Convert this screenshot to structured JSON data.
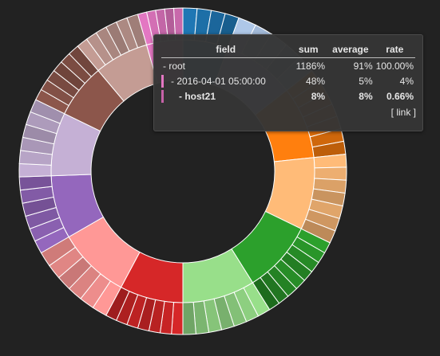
{
  "chart_data": {
    "type": "sunburst",
    "columns": [
      "field",
      "sum",
      "average",
      "rate"
    ],
    "root": {
      "name": "root",
      "children": [
        {
          "color": "#1f77b4",
          "value": 5,
          "children": 4
        },
        {
          "color": "#aec7e8",
          "value": 8,
          "children": 5
        },
        {
          "color": "#ff7f0e",
          "value": 8,
          "children": 7
        },
        {
          "color": "#ffbb78",
          "value": 8,
          "children": 7
        },
        {
          "color": "#2ca02c",
          "value": 8,
          "children": 8
        },
        {
          "color": "#98df8a",
          "value": 8,
          "children": 7
        },
        {
          "color": "#d62728",
          "value": 7,
          "children": 7
        },
        {
          "color": "#ff9896",
          "value": 8,
          "children": 6
        },
        {
          "color": "#9467bd",
          "value": 7,
          "children": 6
        },
        {
          "color": "#c5b0d5",
          "value": 7,
          "children": 6
        },
        {
          "color": "#8c564b",
          "value": 6,
          "children": 6
        },
        {
          "color": "#c49c94",
          "value": 6,
          "children": 6
        },
        {
          "color": "#e377c2",
          "value": 4,
          "children": 5
        }
      ]
    }
  },
  "tooltip": {
    "headers": {
      "field": "field",
      "sum": "sum",
      "average": "average",
      "rate": "rate"
    },
    "rows": [
      {
        "field": "- root",
        "sum": "1186%",
        "average": "91%",
        "rate": "100.00%",
        "swatch": ""
      },
      {
        "field": "- 2016-04-01 05:00:00",
        "sum": "48%",
        "average": "5%",
        "rate": "4%",
        "swatch": "#e377c2"
      },
      {
        "field": "- host21",
        "sum": "8%",
        "average": "8%",
        "rate": "0.66%",
        "swatch": "#c762a8"
      }
    ],
    "link_label": "[ link ]"
  }
}
